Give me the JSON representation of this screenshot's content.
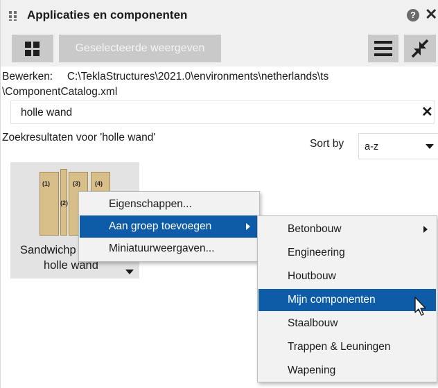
{
  "window": {
    "title": "Applicaties en componenten",
    "help_icon": "help-icon",
    "help_glyph": "?",
    "close_icon": "close-icon",
    "close_glyph": "✕"
  },
  "toolbar": {
    "grid_icon": "grid-view-icon",
    "selected_views_label": "Geselecteerde weergeven",
    "menu_icon": "hamburger-menu-icon",
    "collapse_icon": "collapse-arrows-icon"
  },
  "edit_path": {
    "label": "Bewerken:",
    "path_line1": "C:\\TeklaStructures\\2021.0\\environments\\netherlands\\ts",
    "path_line2": "\\ComponentCatalog.xml"
  },
  "search": {
    "value": "holle wand",
    "clear_glyph": "✕"
  },
  "results": {
    "label": "Zoekresultaten voor 'holle wand'",
    "sort_label": "Sort by",
    "sort_value": "a-z"
  },
  "component_tile": {
    "name_line1": "Sandwichp",
    "name_line2": "holle wand",
    "thumbnail_numbers": [
      "(1)",
      "(2)",
      "(3)",
      "(4)"
    ]
  },
  "context_menu": {
    "items": [
      {
        "label": "Eigenschappen..."
      },
      {
        "label": "Aan groep toevoegen",
        "has_submenu": true,
        "active": true
      },
      {
        "label": "Miniatuurweergaven..."
      }
    ]
  },
  "submenu": {
    "items": [
      {
        "label": "Betonbouw",
        "has_submenu": true
      },
      {
        "label": "Engineering"
      },
      {
        "label": "Houtbouw"
      },
      {
        "label": "Mijn componenten",
        "active": true
      },
      {
        "label": "Staalbouw"
      },
      {
        "label": "Trappen & Leuningen"
      },
      {
        "label": "Wapening"
      }
    ]
  },
  "colors": {
    "highlight": "#0e5ca8",
    "toolbar_bg": "#f0f0f0",
    "button_bg": "#c9c9c9",
    "tile_bg": "#e3e3e3",
    "thumbnail_panel": "#d8bf8a"
  }
}
